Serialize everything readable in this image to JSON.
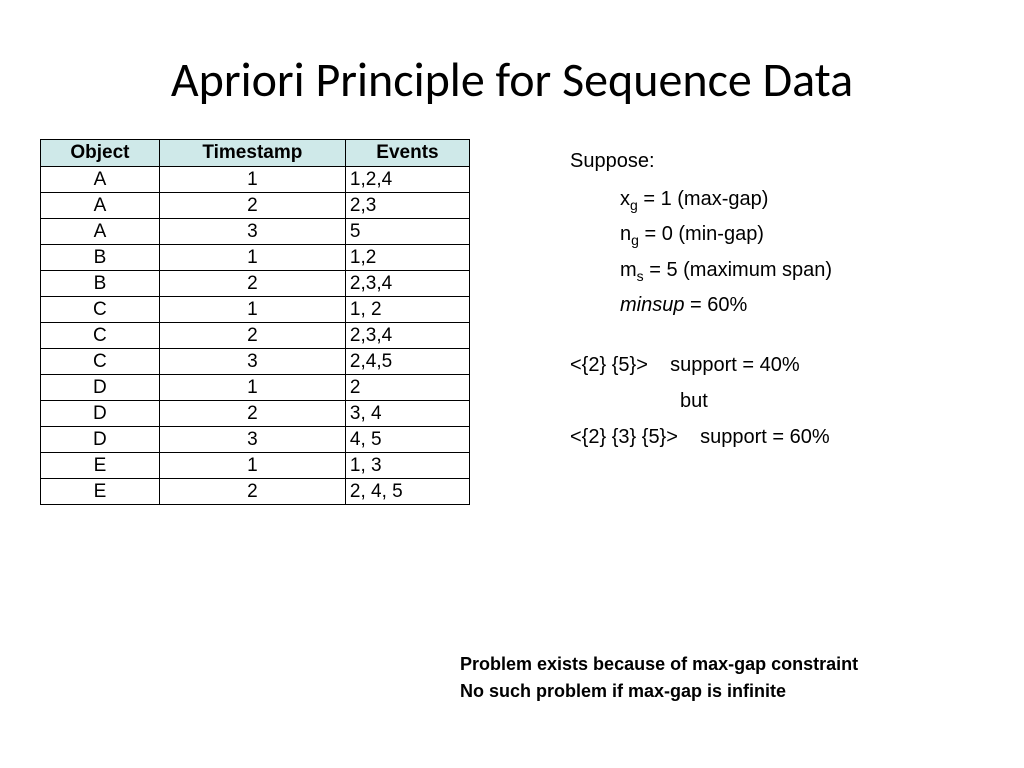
{
  "title": "Apriori Principle for Sequence Data",
  "table": {
    "headers": [
      "Object",
      "Timestamp",
      "Events"
    ],
    "rows": [
      {
        "object": "A",
        "timestamp": "1",
        "events": "1,2,4"
      },
      {
        "object": "A",
        "timestamp": "2",
        "events": "2,3"
      },
      {
        "object": "A",
        "timestamp": "3",
        "events": "5"
      },
      {
        "object": "B",
        "timestamp": "1",
        "events": "1,2"
      },
      {
        "object": "B",
        "timestamp": "2",
        "events": "2,3,4"
      },
      {
        "object": "C",
        "timestamp": "1",
        "events": "1, 2"
      },
      {
        "object": "C",
        "timestamp": "2",
        "events": "2,3,4"
      },
      {
        "object": "C",
        "timestamp": "3",
        "events": "2,4,5"
      },
      {
        "object": "D",
        "timestamp": "1",
        "events": "2"
      },
      {
        "object": "D",
        "timestamp": "2",
        "events": "3, 4"
      },
      {
        "object": "D",
        "timestamp": "3",
        "events": "4, 5"
      },
      {
        "object": "E",
        "timestamp": "1",
        "events": "1, 3"
      },
      {
        "object": "E",
        "timestamp": "2",
        "events": "2, 4, 5"
      }
    ]
  },
  "right": {
    "suppose_label": "Suppose:",
    "xg_var": "x",
    "xg_sub": "g",
    "xg_rest": " = 1 (max-gap)",
    "ng_var": "n",
    "ng_sub": "g",
    "ng_rest": " = 0 (min-gap)",
    "ms_var": "m",
    "ms_sub": "s",
    "ms_rest": " = 5 (maximum span)",
    "minsup_var": "minsup",
    "minsup_rest": " = 60%",
    "seq1_pat": "<{2} {5}>",
    "seq1_sup": "    support = 40%",
    "but": "but",
    "seq2_pat": "<{2} {3} {5}>",
    "seq2_sup": "    support = 60%"
  },
  "footer": {
    "line1": "Problem exists because of max-gap constraint",
    "line2": "No such problem if max-gap is infinite"
  }
}
